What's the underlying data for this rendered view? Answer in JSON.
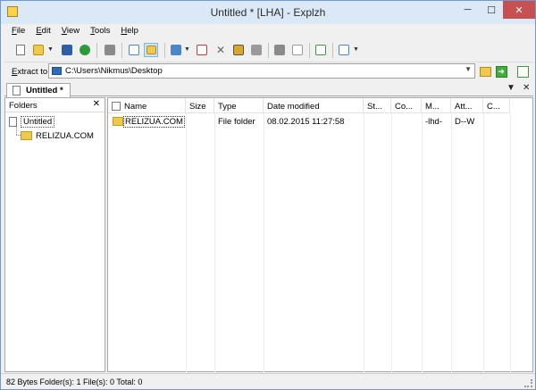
{
  "window": {
    "title": "Untitled * [LHA] - Explzh",
    "minimize_glyph": "─",
    "maximize_glyph": "☐",
    "close_glyph": "✕"
  },
  "menu": {
    "file_u": "F",
    "file_rest": "ile",
    "edit_u": "E",
    "edit_rest": "dit",
    "view_u": "V",
    "view_rest": "iew",
    "tools_u": "T",
    "tools_rest": "ools",
    "help_u": "H",
    "help_rest": "elp"
  },
  "toolbar": {
    "icons": [
      "new-archive",
      "open",
      "save",
      "lha-convert",
      "extract",
      "comment",
      "open-folder",
      "add",
      "delete-file",
      "cut",
      "copy",
      "paste",
      "tag",
      "view-list",
      "properties",
      "window"
    ],
    "colors": {
      "new": "#ffffff",
      "open": "#f0c84a",
      "save": "#2b5fa8",
      "lha": "#2e9b3b",
      "gray": "#8a8a8a",
      "blue": "#4a86c8",
      "red": "#c23b3b",
      "gold": "#d9a925",
      "green": "#3f9b3f"
    }
  },
  "extract": {
    "label_u": "E",
    "label_rest": "xtract to",
    "path": "C:\\Users\\Nikmus\\Desktop"
  },
  "tabs": [
    {
      "label": "Untitled *"
    }
  ],
  "tab_controls": {
    "dropdown": "▼",
    "close": "✕"
  },
  "folders": {
    "title": "Folders",
    "close": "✕",
    "tree": [
      {
        "label": "Untitled",
        "kind": "archive"
      },
      {
        "label": "RELIZUA.COM",
        "kind": "folder"
      }
    ]
  },
  "filelist": {
    "columns": [
      "Name",
      "Size",
      "Type",
      "Date modified",
      "St...",
      "Co...",
      "M...",
      "Att...",
      "C..."
    ],
    "rows": [
      {
        "name": "RELIZUA.COM",
        "size": "",
        "type": "File folder",
        "date": "08.02.2015 11:27:58",
        "st": "",
        "co": "",
        "mode": "-lhd-",
        "attr": "D--W",
        "c": ""
      }
    ]
  },
  "status": {
    "text": "82 Bytes  Folder(s): 1  File(s): 0  Total: 0"
  },
  "colors": {
    "accent": "#6d9bd0",
    "close_red": "#c75050",
    "folder_yellow": "#f0c84a"
  }
}
